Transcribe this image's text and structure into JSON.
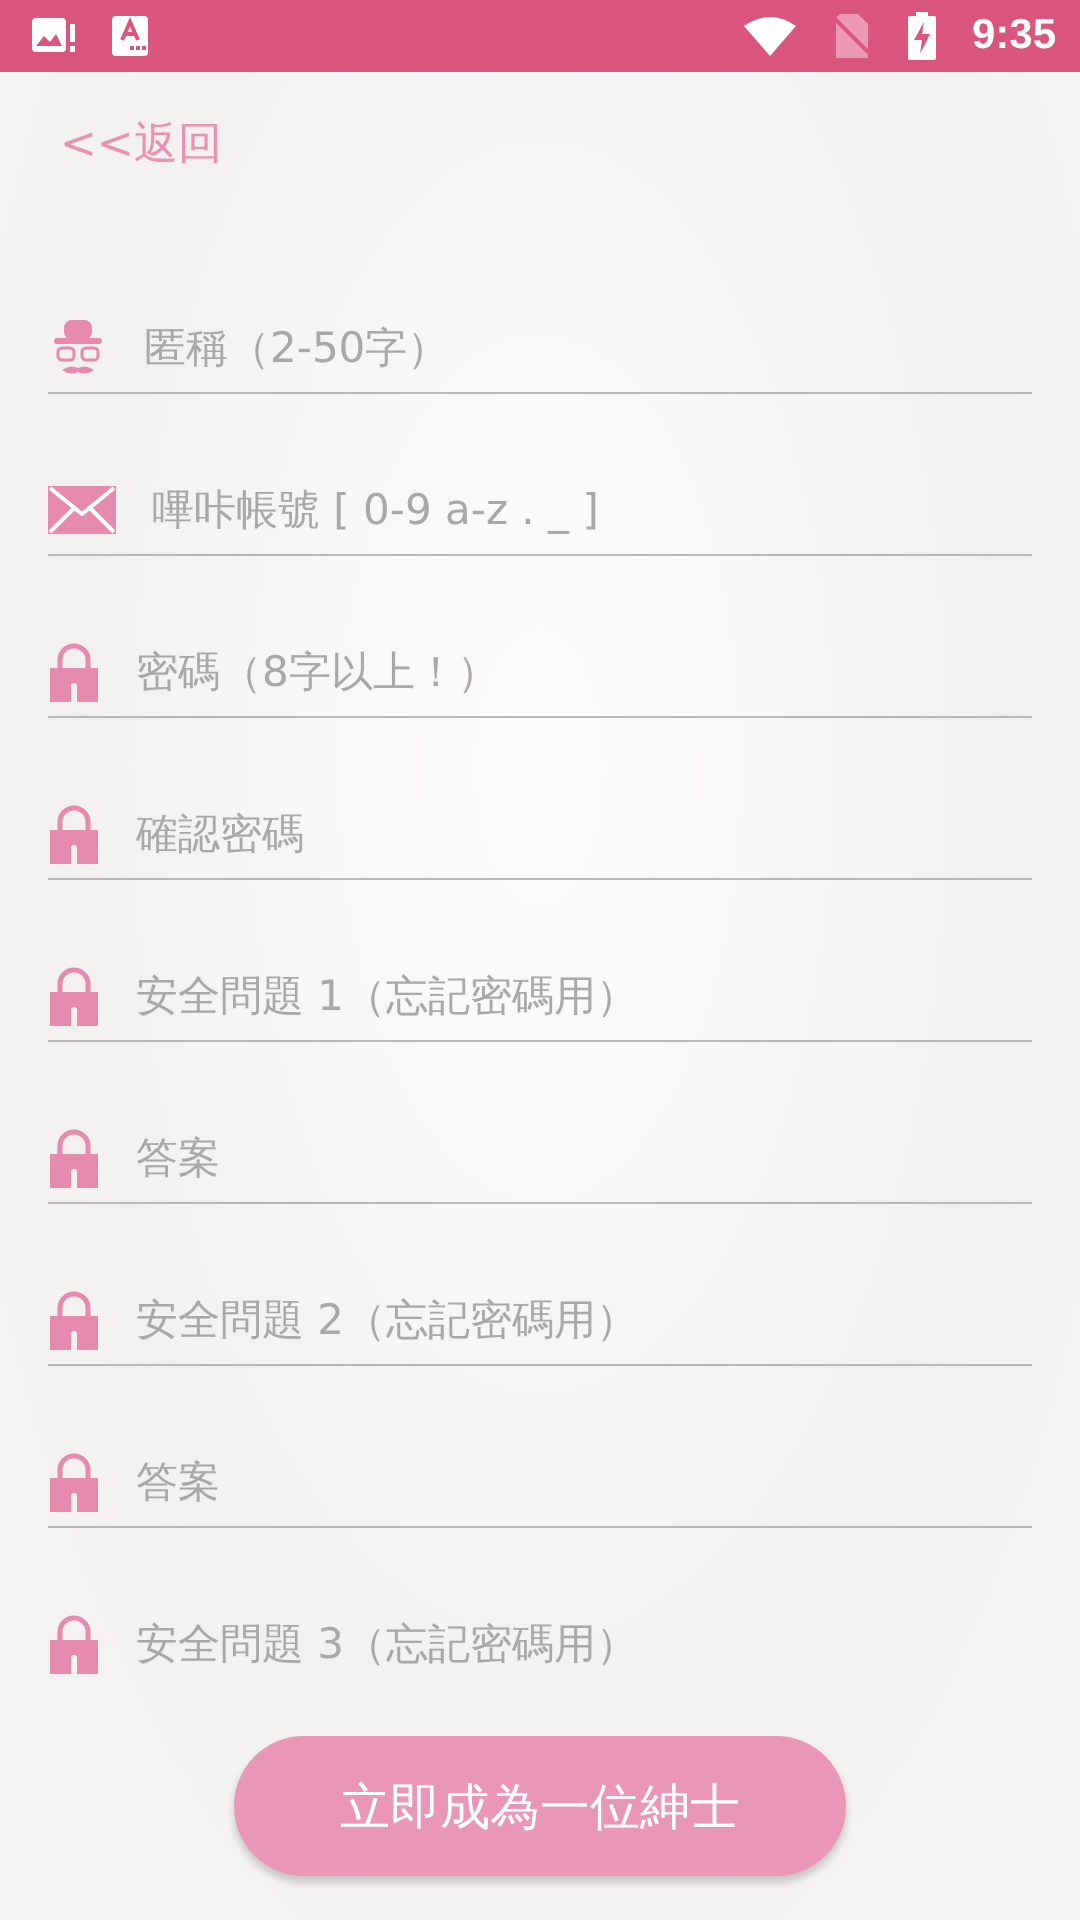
{
  "status_bar": {
    "time": "9:35"
  },
  "back_link": "<<返回",
  "fields": [
    {
      "kind": "nickname",
      "placeholder": "匿稱（2-50字）"
    },
    {
      "kind": "account",
      "placeholder": "嗶咔帳號 [ 0-9 a-z . _ ]"
    },
    {
      "kind": "secret",
      "placeholder": "密碼（8字以上！）"
    },
    {
      "kind": "secret",
      "placeholder": "確認密碼"
    },
    {
      "kind": "secret",
      "placeholder": "安全問題 1（忘記密碼用）"
    },
    {
      "kind": "secret",
      "placeholder": "答案"
    },
    {
      "kind": "secret",
      "placeholder": "安全問題 2（忘記密碼用）"
    },
    {
      "kind": "secret",
      "placeholder": "答案"
    },
    {
      "kind": "secret",
      "placeholder": "安全問題 3（忘記密碼用）"
    }
  ],
  "submit_button": "立即成為一位紳士"
}
